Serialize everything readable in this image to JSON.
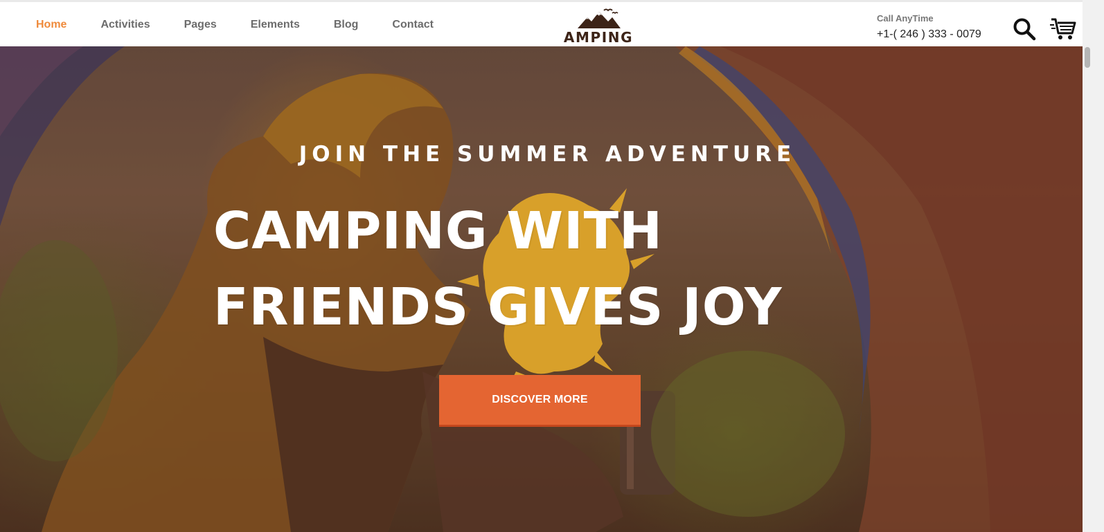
{
  "header": {
    "nav": [
      {
        "label": "Home",
        "active": true
      },
      {
        "label": "Activities"
      },
      {
        "label": "Pages"
      },
      {
        "label": "Elements"
      },
      {
        "label": "Blog"
      },
      {
        "label": "Contact"
      }
    ],
    "logo_text": "AMPING",
    "call_label": "Call AnyTime",
    "phone": "+1-( 246 ) 333 - 0079",
    "icons": {
      "search": "search-icon",
      "cart": "cart-icon"
    }
  },
  "hero": {
    "subtitle": "JOIN THE SUMMER ADVENTURE",
    "headline_line1": "CAMPING WITH",
    "headline_line2": "FRIENDS GIVES JOY",
    "cta_label": "DISCOVER MORE"
  },
  "colors": {
    "accent": "#ef8a3b",
    "button": "#e46532",
    "splash": "#fbbd2f",
    "nav_text": "#6c6c6c",
    "logo": "#3d2418"
  }
}
